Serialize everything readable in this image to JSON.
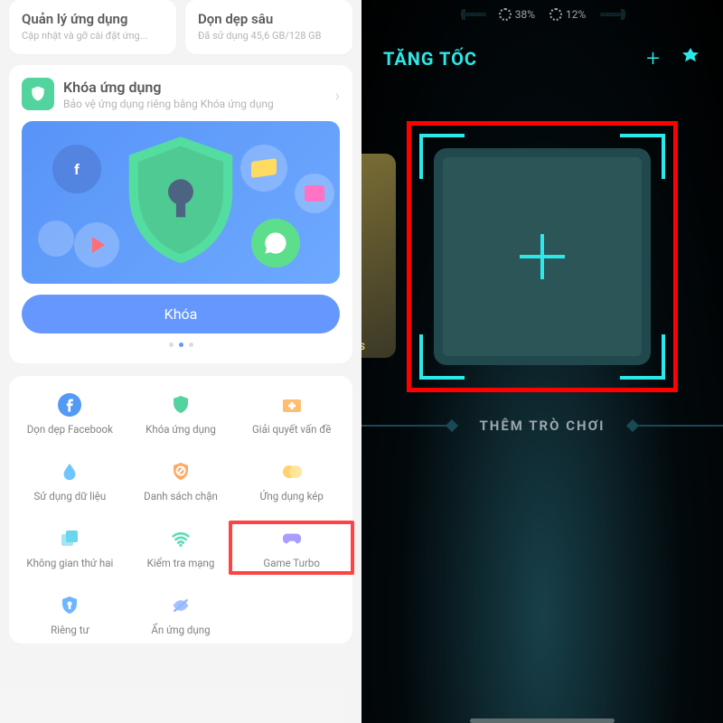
{
  "left": {
    "topCards": [
      {
        "title": "Quản lý ứng dụng",
        "sub": "Cập nhật và gỡ cài đặt ứng..."
      },
      {
        "title": "Dọn dẹp sâu",
        "sub": "Đã sử dụng 45,6 GB/128 GB"
      }
    ],
    "lock": {
      "title": "Khóa ứng dụng",
      "sub": "Bảo vệ ứng dụng riêng bằng Khóa ứng dụng",
      "button": "Khóa"
    },
    "tools": [
      {
        "id": "facebook-cleanup",
        "label": "Dọn dẹp Facebook",
        "icon": "fb"
      },
      {
        "id": "app-lock",
        "label": "Khóa ứng dụng",
        "icon": "shield"
      },
      {
        "id": "solve-problems",
        "label": "Giải quyết vấn đề",
        "icon": "firstaid"
      },
      {
        "id": "data-usage",
        "label": "Sử dụng dữ liệu",
        "icon": "drop"
      },
      {
        "id": "blocklist",
        "label": "Danh sách chặn",
        "icon": "block"
      },
      {
        "id": "dual-apps",
        "label": "Ứng dụng kép",
        "icon": "dual"
      },
      {
        "id": "second-space",
        "label": "Không gian thứ hai",
        "icon": "stack"
      },
      {
        "id": "network-test",
        "label": "Kiểm tra mạng",
        "icon": "wifi"
      },
      {
        "id": "game-turbo",
        "label": "Game Turbo",
        "icon": "game",
        "highlight": true
      },
      {
        "id": "privacy",
        "label": "Riêng tư",
        "icon": "privacy"
      },
      {
        "id": "hide-apps",
        "label": "Ẩn ứng dụng",
        "icon": "hide"
      }
    ]
  },
  "right": {
    "stats": [
      {
        "label": "38%"
      },
      {
        "label": "12%"
      }
    ],
    "title": "TĂNG TỐC",
    "addLabel": "THÊM TRÒ CHƠI",
    "thumbTag": "ES"
  },
  "icons": {
    "fb": "#1877f2",
    "shield": "#18c47b",
    "firstaid": "#ffa83d",
    "drop": "#3cb3ff",
    "block": "#ff8a2b",
    "dual": "#ffc23d",
    "stack": "#35c8e8",
    "wifi": "#2ecfa3",
    "game": "#8a7cff",
    "privacy": "#3c9bff",
    "hide": "#6e9dff"
  }
}
